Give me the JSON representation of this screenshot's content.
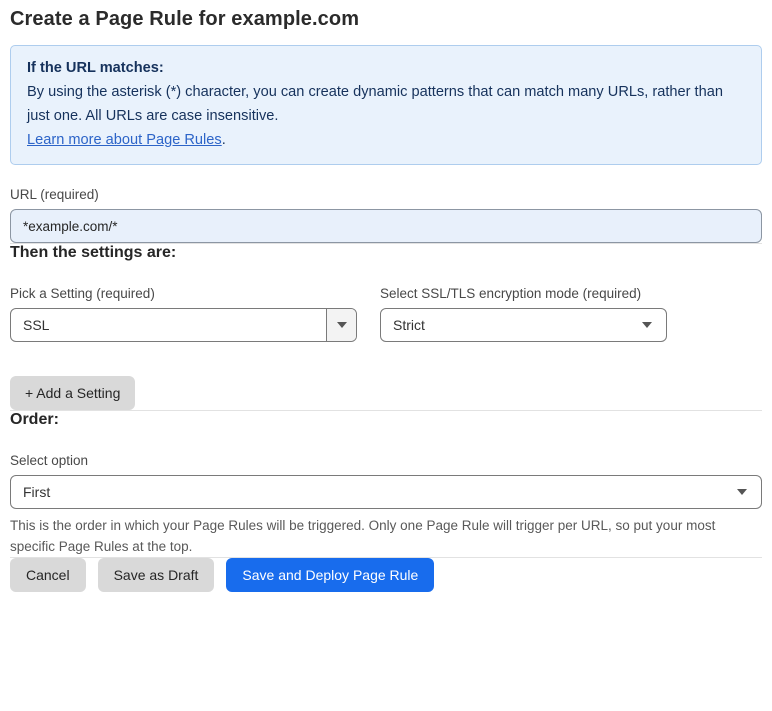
{
  "page": {
    "title": "Create a Page Rule for example.com"
  },
  "info_box": {
    "heading": "If the URL matches:",
    "body": "By using the asterisk (*) character, you can create dynamic patterns that can match many URLs, rather than just one. All URLs are case insensitive.",
    "link_label": "Learn more about Page Rules",
    "link_suffix": "."
  },
  "url_field": {
    "label": "URL (required)",
    "value": "*example.com/*"
  },
  "settings_section": {
    "heading": "Then the settings are:",
    "pick_setting": {
      "label": "Pick a Setting (required)",
      "value": "SSL"
    },
    "ssl_mode": {
      "label": "Select SSL/TLS encryption mode (required)",
      "value": "Strict"
    },
    "add_setting_label": "+ Add a Setting"
  },
  "order_section": {
    "heading": "Order:",
    "select_label": "Select option",
    "value": "First",
    "help_text": "This is the order in which your Page Rules will be triggered. Only one Page Rule will trigger per URL, so put your most specific Page Rules at the top."
  },
  "footer": {
    "cancel_label": "Cancel",
    "save_draft_label": "Save as Draft",
    "save_deploy_label": "Save and Deploy Page Rule"
  },
  "colors": {
    "accent_blue": "#186ced",
    "info_box_bg": "#e9f2fc",
    "info_box_border": "#aecdee",
    "info_text_navy": "#16325c",
    "link_blue": "#2c64c8",
    "url_input_bg": "#e8f0fb",
    "gray_button_bg": "#d9d9d9"
  },
  "icons": {
    "dropdown_caret": "caret-down"
  }
}
